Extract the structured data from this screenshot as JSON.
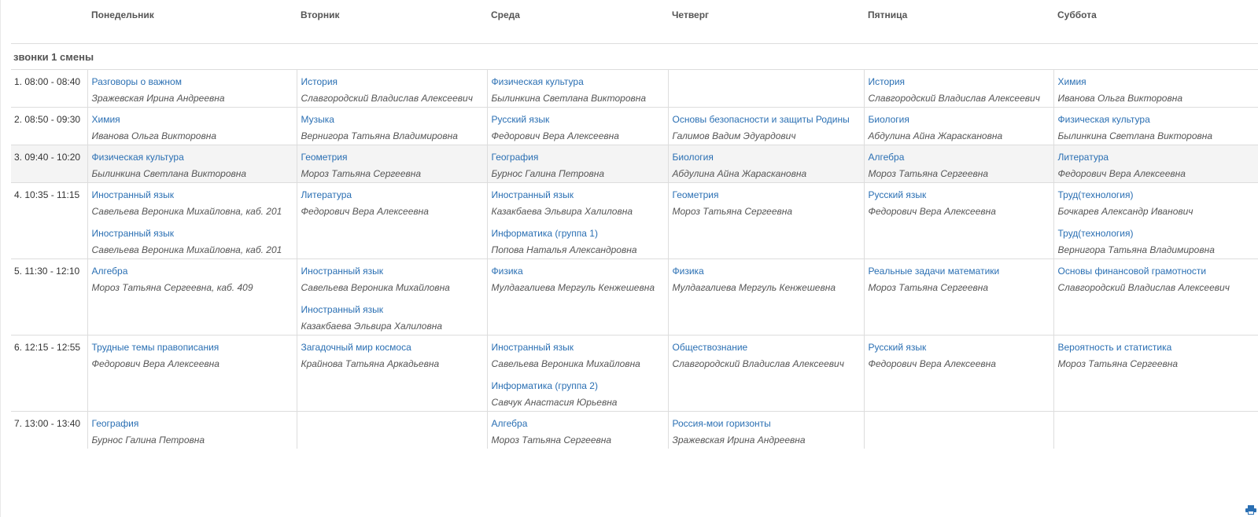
{
  "days": [
    "Понедельник",
    "Вторник",
    "Среда",
    "Четверг",
    "Пятница",
    "Суббота"
  ],
  "shift_label": "звонки 1 смены",
  "lessons": [
    {
      "time": "1. 08:00 - 08:40",
      "cells": [
        [
          {
            "subject": "Разговоры о важном",
            "teacher": "Зражевская Ирина Андреевна"
          }
        ],
        [
          {
            "subject": "История",
            "teacher": "Славгородский Владислав Алексеевич"
          }
        ],
        [
          {
            "subject": "Физическая культура",
            "teacher": "Былинкина Светлана Викторовна"
          }
        ],
        [],
        [
          {
            "subject": "История",
            "teacher": "Славгородский Владислав Алексеевич"
          }
        ],
        [
          {
            "subject": "Химия",
            "teacher": "Иванова Ольга Викторовна"
          }
        ]
      ]
    },
    {
      "time": "2. 08:50 - 09:30",
      "cells": [
        [
          {
            "subject": "Химия",
            "teacher": "Иванова Ольга Викторовна"
          }
        ],
        [
          {
            "subject": "Музыка",
            "teacher": "Вернигора Татьяна Владимировна"
          }
        ],
        [
          {
            "subject": "Русский язык",
            "teacher": "Федорович Вера Алексеевна"
          }
        ],
        [
          {
            "subject": "Основы безопасности и защиты Родины",
            "teacher": "Галимов Вадим Эдуардович"
          }
        ],
        [
          {
            "subject": "Биология",
            "teacher": "Абдулина Айна Жараскановна"
          }
        ],
        [
          {
            "subject": "Физическая культура",
            "teacher": "Былинкина Светлана Викторовна"
          }
        ]
      ]
    },
    {
      "time": "3. 09:40 - 10:20",
      "shaded": true,
      "cells": [
        [
          {
            "subject": "Физическая культура",
            "teacher": "Былинкина Светлана Викторовна"
          }
        ],
        [
          {
            "subject": "Геометрия",
            "teacher": "Мороз Татьяна Сергеевна"
          }
        ],
        [
          {
            "subject": "География",
            "teacher": "Бурнос Галина Петровна"
          }
        ],
        [
          {
            "subject": "Биология",
            "teacher": "Абдулина Айна Жараскановна"
          }
        ],
        [
          {
            "subject": "Алгебра",
            "teacher": "Мороз Татьяна Сергеевна"
          }
        ],
        [
          {
            "subject": "Литература",
            "teacher": "Федорович Вера Алексеевна"
          }
        ]
      ]
    },
    {
      "time": "4. 10:35 - 11:15",
      "cells": [
        [
          {
            "subject": "Иностранный язык",
            "teacher": "Савельева Вероника Михайловна, каб. 201"
          },
          {
            "subject": "Иностранный язык",
            "teacher": "Савельева Вероника Михайловна, каб. 201"
          }
        ],
        [
          {
            "subject": "Литература",
            "teacher": "Федорович Вера Алексеевна"
          }
        ],
        [
          {
            "subject": "Иностранный язык",
            "teacher": "Казакбаева Эльвира Халиловна"
          },
          {
            "subject": "Информатика (группа 1)",
            "teacher": "Попова Наталья Александровна"
          }
        ],
        [
          {
            "subject": "Геометрия",
            "teacher": "Мороз Татьяна Сергеевна"
          }
        ],
        [
          {
            "subject": "Русский язык",
            "teacher": "Федорович Вера Алексеевна"
          }
        ],
        [
          {
            "subject": "Труд(технология)",
            "teacher": "Бочкарев Александр Иванович"
          },
          {
            "subject": "Труд(технология)",
            "teacher": "Вернигора Татьяна Владимировна"
          }
        ]
      ]
    },
    {
      "time": "5. 11:30 - 12:10",
      "cells": [
        [
          {
            "subject": "Алгебра",
            "teacher": "Мороз Татьяна Сергеевна, каб. 409"
          }
        ],
        [
          {
            "subject": "Иностранный язык",
            "teacher": "Савельева Вероника Михайловна"
          },
          {
            "subject": "Иностранный язык",
            "teacher": "Казакбаева Эльвира Халиловна"
          }
        ],
        [
          {
            "subject": "Физика",
            "teacher": "Мулдагалиева Мергуль Кенжешевна"
          }
        ],
        [
          {
            "subject": "Физика",
            "teacher": "Мулдагалиева Мергуль Кенжешевна"
          }
        ],
        [
          {
            "subject": "Реальные задачи математики",
            "teacher": "Мороз Татьяна Сергеевна"
          }
        ],
        [
          {
            "subject": "Основы финансовой грамотности",
            "teacher": "Славгородский Владислав Алексеевич"
          }
        ]
      ]
    },
    {
      "time": "6. 12:15 - 12:55",
      "cells": [
        [
          {
            "subject": "Трудные темы правописания",
            "teacher": "Федорович Вера Алексеевна"
          }
        ],
        [
          {
            "subject": "Загадочный мир космоса",
            "teacher": "Крайнова Татьяна Аркадьевна"
          }
        ],
        [
          {
            "subject": "Иностранный язык",
            "teacher": "Савельева Вероника Михайловна"
          },
          {
            "subject": "Информатика (группа 2)",
            "teacher": "Савчук Анастасия Юрьевна"
          }
        ],
        [
          {
            "subject": "Обществознание",
            "teacher": "Славгородский Владислав Алексеевич"
          }
        ],
        [
          {
            "subject": "Русский язык",
            "teacher": "Федорович Вера Алексеевна"
          }
        ],
        [
          {
            "subject": "Вероятность и статистика",
            "teacher": "Мороз Татьяна Сергеевна"
          }
        ]
      ]
    },
    {
      "time": "7. 13:00 - 13:40",
      "cells": [
        [
          {
            "subject": "География",
            "teacher": "Бурнос Галина Петровна"
          }
        ],
        [],
        [
          {
            "subject": "Алгебра",
            "teacher": "Мороз Татьяна Сергеевна"
          }
        ],
        [
          {
            "subject": "Россия-мои горизонты",
            "teacher": "Зражевская Ирина Андреевна"
          }
        ],
        [],
        []
      ]
    }
  ],
  "icons": {
    "print": "print-icon"
  },
  "colors": {
    "link": "#2a6fb3",
    "shaded_row": "#f4f4f4",
    "border": "#dddddd"
  }
}
